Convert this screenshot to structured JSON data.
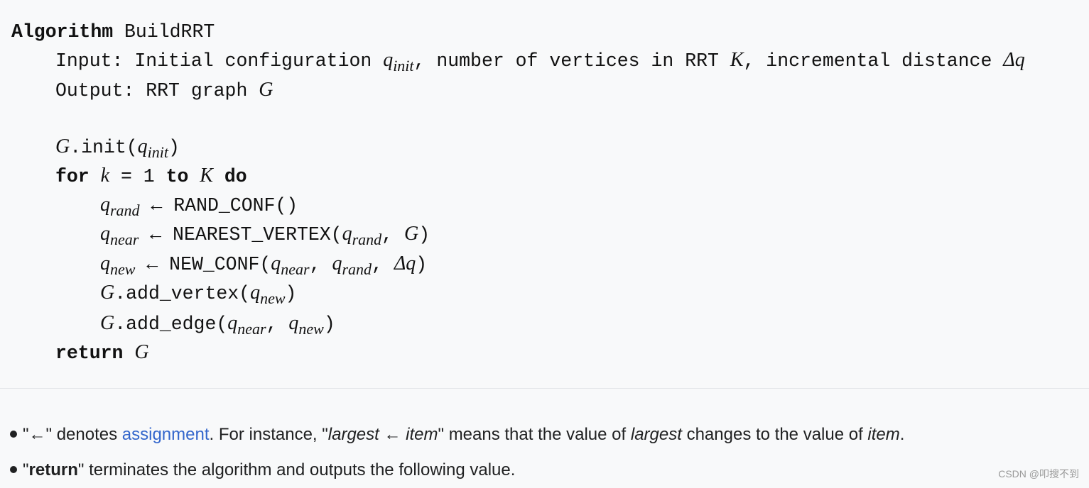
{
  "algorithm": {
    "keyword": "Algorithm",
    "name": "BuildRRT",
    "input_label": "Input: Initial configuration ",
    "q": "q",
    "init": "init",
    "input_mid": ", number of vertices in RRT ",
    "K": "K",
    "input_end": ", incremental distance ",
    "dq": "Δq",
    "output_label": "Output: RRT graph ",
    "G": "G",
    "init_call": ".init(",
    "rp": ")",
    "for": "for",
    "k": "k",
    "eq": " = 1 ",
    "to": "to",
    "do": "do",
    "rand": "rand",
    "near": "near",
    "new": "new",
    "arrow": " ← ",
    "rand_conf": "RAND_CONF()",
    "nearest": "NEAREST_VERTEX(",
    "new_conf": "NEW_CONF(",
    "comma": ", ",
    "add_vertex": ".add_vertex(",
    "add_edge": ".add_edge(",
    "return": "return"
  },
  "notes": [
    {
      "q1": "\"←\" denotes ",
      "link": "assignment",
      "t2": ". For instance, \"",
      "i1": "largest",
      "t3": " ← ",
      "i2": "item",
      "t4": "\" means that the value of ",
      "i3": "largest",
      "t5": " changes to the value of ",
      "i4": "item",
      "t6": "."
    },
    {
      "q1": "\"",
      "b": "return",
      "t2": "\" terminates the algorithm and outputs the following value."
    }
  ],
  "watermark": "CSDN @叩搜不到"
}
